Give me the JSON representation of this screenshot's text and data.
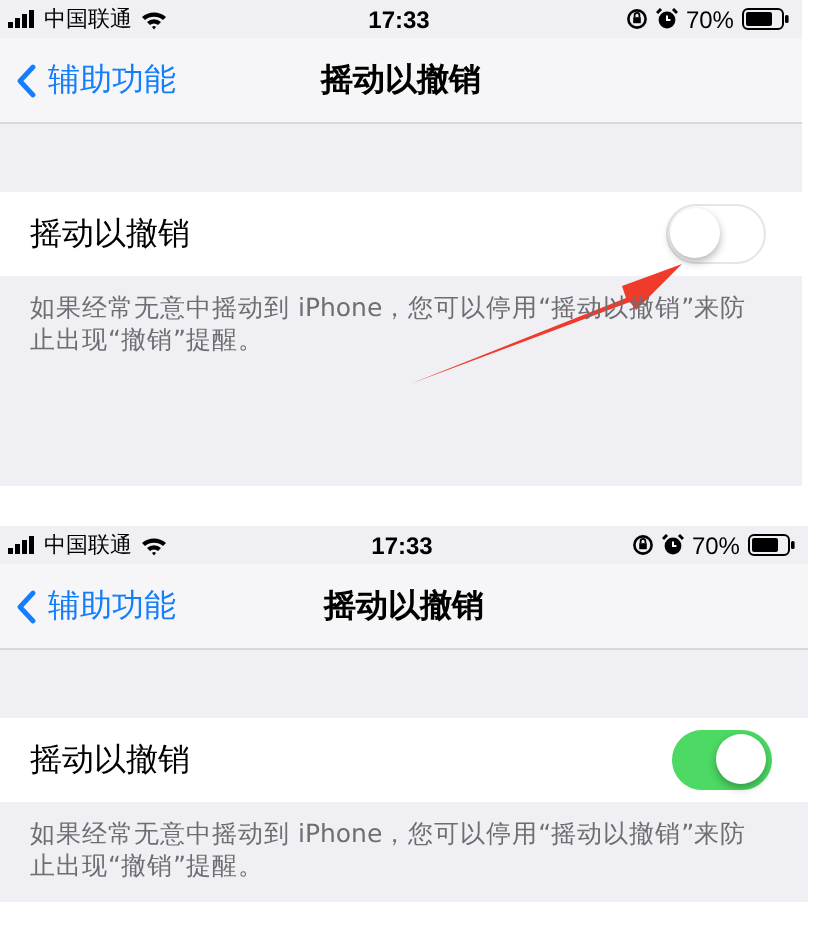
{
  "screens": [
    {
      "status_bar": {
        "carrier": "中国联通",
        "time": "17:33",
        "battery": "70%"
      },
      "nav": {
        "back": "辅助功能",
        "title": "摇动以撤销"
      },
      "setting": {
        "label": "摇动以撤销",
        "on": false
      },
      "footer": "如果经常无意中摇动到 iPhone，您可以停用“摇动以撤销”来防止出现“撤销”提醒。",
      "pointer_arrow": true
    },
    {
      "status_bar": {
        "carrier": "中国联通",
        "time": "17:33",
        "battery": "70%"
      },
      "nav": {
        "back": "辅助功能",
        "title": "摇动以撤销"
      },
      "setting": {
        "label": "摇动以撤销",
        "on": true
      },
      "footer": "如果经常无意中摇动到 iPhone，您可以停用“摇动以撤销”来防止出现“撤销”提醒。"
    }
  ]
}
